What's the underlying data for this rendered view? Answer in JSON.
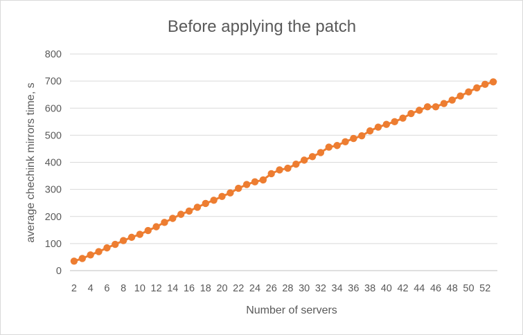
{
  "chart_data": {
    "type": "line",
    "title": "Before applying the patch",
    "xlabel": "Number of servers",
    "ylabel": "average chechink mirrors time, s",
    "x": [
      2,
      3,
      4,
      5,
      6,
      7,
      8,
      9,
      10,
      11,
      12,
      13,
      14,
      15,
      16,
      17,
      18,
      19,
      20,
      21,
      22,
      23,
      24,
      25,
      26,
      27,
      28,
      29,
      30,
      31,
      32,
      33,
      34,
      35,
      36,
      37,
      38,
      39,
      40,
      41,
      42,
      43,
      44,
      45,
      46,
      47,
      48,
      49,
      50,
      51,
      52,
      53
    ],
    "x_tick_labels": [
      "2",
      "4",
      "6",
      "8",
      "10",
      "12",
      "14",
      "16",
      "18",
      "20",
      "22",
      "24",
      "26",
      "28",
      "30",
      "32",
      "34",
      "36",
      "38",
      "40",
      "42",
      "44",
      "46",
      "48",
      "50",
      "52"
    ],
    "y_tick_labels": [
      "0",
      "100",
      "200",
      "300",
      "400",
      "500",
      "600",
      "700",
      "800"
    ],
    "ylim": [
      0,
      800
    ],
    "grid": true,
    "legend": "none",
    "series": [
      {
        "color": "#ED7D31",
        "values": [
          35,
          45,
          58,
          70,
          84,
          97,
          111,
          123,
          134,
          148,
          162,
          178,
          193,
          208,
          220,
          234,
          248,
          260,
          274,
          287,
          304,
          318,
          328,
          335,
          358,
          372,
          378,
          393,
          408,
          421,
          436,
          456,
          462,
          476,
          488,
          498,
          516,
          530,
          540,
          550,
          563,
          580,
          592,
          605,
          605,
          617,
          630,
          645,
          660,
          675,
          688,
          697
        ]
      }
    ]
  }
}
